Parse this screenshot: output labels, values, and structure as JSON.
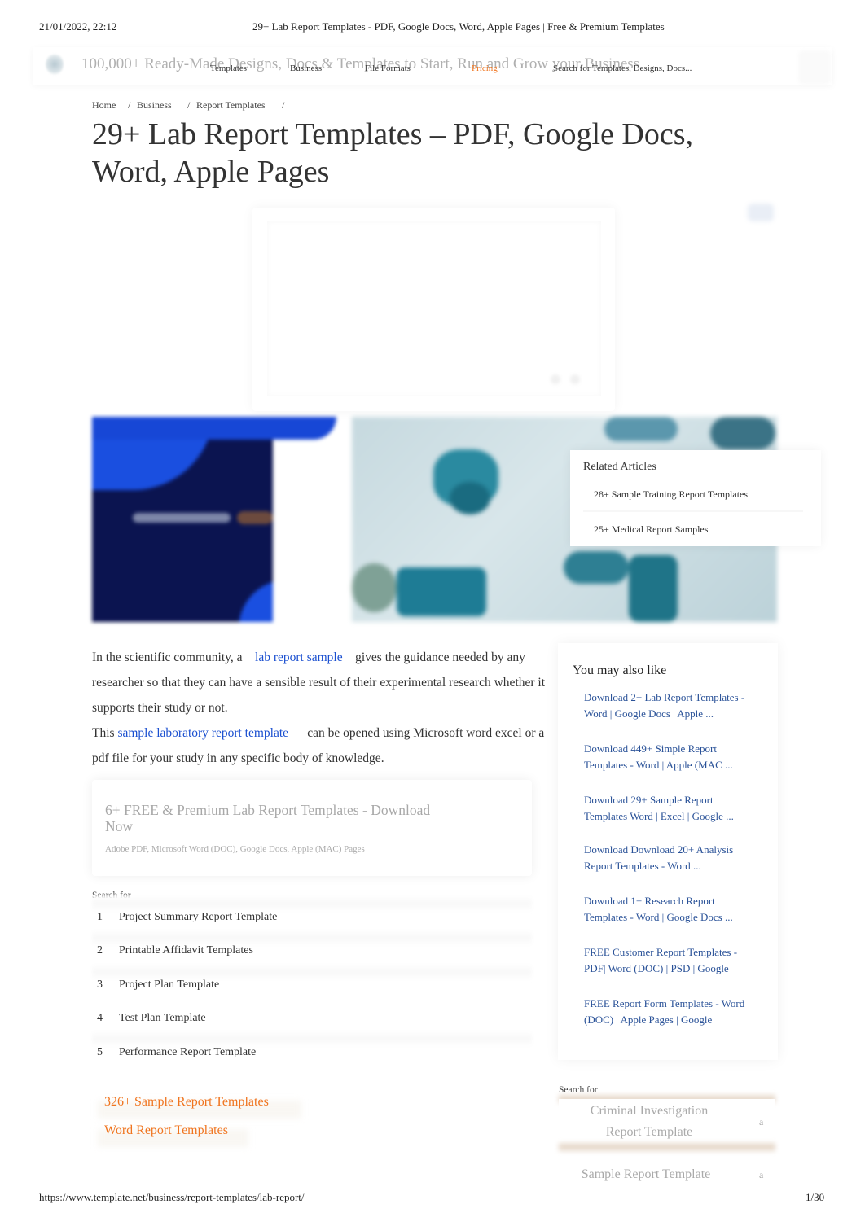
{
  "print_header": {
    "date": "21/01/2022, 22:12",
    "title": "29+ Lab Report Templates - PDF, Google Docs, Word, Apple Pages | Free & Premium Templates"
  },
  "print_footer": {
    "url": "https://www.template.net/business/report-templates/lab-report/",
    "page": "1/30"
  },
  "site_header": {
    "tagline": "100,000+ Ready-Made Designs, Docs & Templates to Start, Run and Grow your Business",
    "nav": [
      "Templates",
      "Business",
      "File Formats",
      "Pricing"
    ],
    "search_placeholder": "Search for Templates, Designs, Docs...",
    "accent_color": "#f0741e"
  },
  "breadcrumb": [
    "Home",
    "Business",
    "Report Templates"
  ],
  "page_title": "29+ Lab Report Templates – PDF, Google Docs, Word, Apple Pages",
  "related_articles": {
    "title": "Related Articles",
    "items": [
      "28+ Sample Training Report Templates",
      "25+ Medical Report Samples"
    ]
  },
  "intro": {
    "p1_before": "In the scientific community, a",
    "p1_link": "lab report sample",
    "p1_after": "gives the guidance needed by any researcher so that they can have a sensible result of their experimental research whether it supports their study or not.",
    "p2_before": "This",
    "p2_link": "sample laboratory report template",
    "p2_after": "can be opened using Microsoft word excel or a pdf file for your study in any specific body of knowledge.",
    "link_color": "#1a4fd0"
  },
  "download_card": {
    "title": "6+ FREE & Premium Lab Report Templates - Download Now",
    "formats": "Adobe PDF, Microsoft Word (DOC), Google Docs, Apple (MAC) Pages"
  },
  "search_for": {
    "label": "Search for",
    "items": [
      {
        "num": "1",
        "text": "Project Summary Report Template"
      },
      {
        "num": "2",
        "text": "Printable Affidavit Templates"
      },
      {
        "num": "3",
        "text": "Project Plan Template"
      },
      {
        "num": "4",
        "text": "Test Plan Template"
      },
      {
        "num": "5",
        "text": "Performance Report Template"
      }
    ]
  },
  "category_links": [
    "326+ Sample Report Templates",
    "Word Report Templates"
  ],
  "sidebar": {
    "title": "You may also like",
    "links": [
      "Download 2+ Lab Report Templates - Word | Google Docs | Apple ...",
      "Download 449+ Simple Report Templates - Word | Apple (MAC ...",
      "Download 29+ Sample Report Templates Word | Excel | Google ...",
      "Download Download 20+ Analysis Report Templates - Word ...",
      "Download 1+ Research Report Templates - Word | Google Docs ...",
      "FREE Customer Report Templates - PDF| Word (DOC) | PSD | Google",
      "FREE Report Form Templates - Word (DOC) | Apple Pages | Google"
    ],
    "link_color": "#2a5298"
  },
  "sidebar_search": {
    "label": "Search for",
    "items": [
      {
        "line1": "Criminal Investigation",
        "line2": "Report Template",
        "marker": "a"
      },
      {
        "line1": "Sample Report Template",
        "line2": "",
        "marker": "a"
      }
    ]
  }
}
